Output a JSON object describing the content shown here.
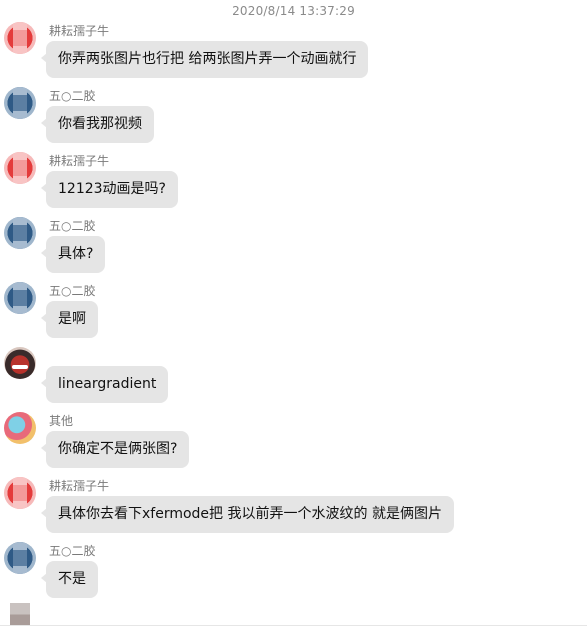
{
  "timestamp": "2020/8/14 13:37:29",
  "messages": [
    {
      "sender": "耕耘孺子牛",
      "avatar": "pixelated-red-avatar",
      "text": "你弄两张图片也行把  给两张图片弄一个动画就行"
    },
    {
      "sender": "五○二胶",
      "avatar": "pixelated-blue-avatar",
      "text": "你看我那视频"
    },
    {
      "sender": "耕耘孺子牛",
      "avatar": "pixelated-red-avatar",
      "text": "12123动画是吗?"
    },
    {
      "sender": "五○二胶",
      "avatar": "pixelated-blue-avatar",
      "text": "具体?"
    },
    {
      "sender": "五○二胶",
      "avatar": "pixelated-blue-avatar",
      "text": "是啊"
    },
    {
      "sender": "",
      "avatar": "photo-avatar",
      "text": "lineargradient"
    },
    {
      "sender": "其他",
      "avatar": "colorful-avatar",
      "text": "你确定不是俩张图?"
    },
    {
      "sender": "耕耘孺子牛",
      "avatar": "pixelated-red-avatar",
      "text": "具体你去看下xfermode把 我以前弄一个水波纹的 就是俩图片"
    },
    {
      "sender": "五○二胶",
      "avatar": "pixelated-blue-avatar",
      "text": "不是"
    }
  ],
  "colors": {
    "bubble_bg": "#e5e5e5",
    "page_bg": "#ffffff",
    "sender_text": "#7a7a7a",
    "timestamp_text": "#8a8a8a"
  }
}
